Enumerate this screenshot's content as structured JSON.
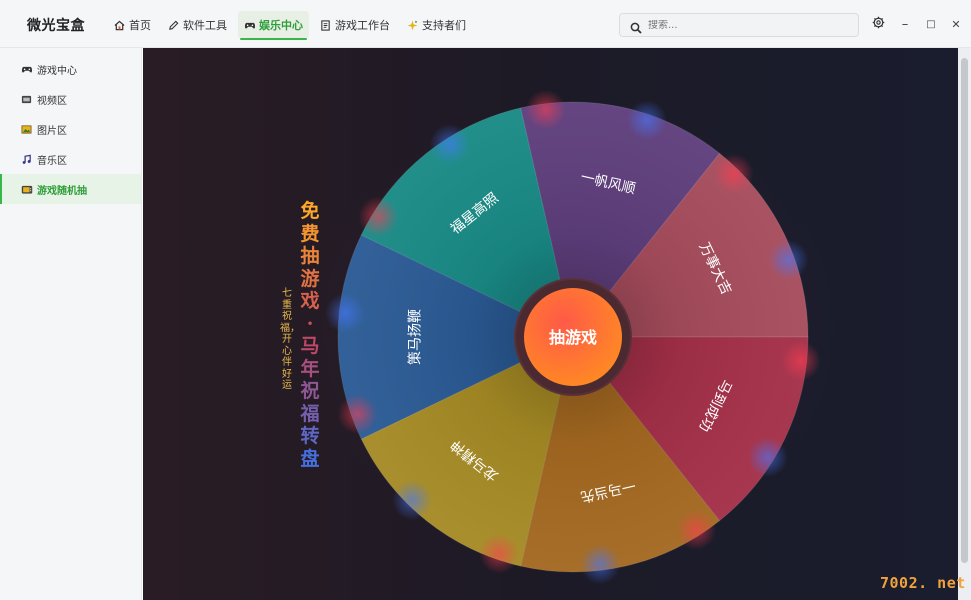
{
  "app": {
    "title": "微光宝盒"
  },
  "nav": {
    "tabs": [
      {
        "label": "首页",
        "icon": "home-icon"
      },
      {
        "label": "软件工具",
        "icon": "pencil-icon"
      },
      {
        "label": "娱乐中心",
        "icon": "gamepad-icon",
        "active": true
      },
      {
        "label": "游戏工作台",
        "icon": "document-icon"
      },
      {
        "label": "支持者们",
        "icon": "sparkle-icon"
      }
    ]
  },
  "search": {
    "placeholder": "搜索..."
  },
  "window_controls": {
    "settings_icon": "gear-icon",
    "minimize": "–",
    "maximize": "□",
    "close": "✕"
  },
  "sidebar": {
    "items": [
      {
        "label": "游戏中心",
        "icon": "gamepad-icon"
      },
      {
        "label": "视频区",
        "icon": "film-icon"
      },
      {
        "label": "图片区",
        "icon": "image-icon"
      },
      {
        "label": "音乐区",
        "icon": "music-note-icon"
      },
      {
        "label": "游戏随机抽",
        "icon": "retro-tv-icon",
        "active": true
      }
    ]
  },
  "wheel": {
    "title_chars": [
      "免",
      "费",
      "抽",
      "游",
      "戏",
      "·",
      "马",
      "年",
      "祝",
      "福",
      "转",
      "盘"
    ],
    "subtitle": "七重祝福，开心伴好运",
    "center_label": "抽游戏",
    "segments": [
      {
        "label": "万事大吉",
        "color": "#a64c5c"
      },
      {
        "label": "马到成功",
        "color": "#a32f48"
      },
      {
        "label": "一马当先",
        "color": "#a36820"
      },
      {
        "label": "龙马精神",
        "color": "#a58a24"
      },
      {
        "label": "策马扬鞭",
        "color": "#2a5a94"
      },
      {
        "label": "福星高照",
        "color": "#198a86"
      },
      {
        "label": "一帆风顺",
        "color": "#5e3e7c"
      }
    ],
    "accent_colors": [
      "#ff5a4a",
      "#ff8a28",
      "#3a6cff"
    ]
  },
  "watermark": "7002. net"
}
